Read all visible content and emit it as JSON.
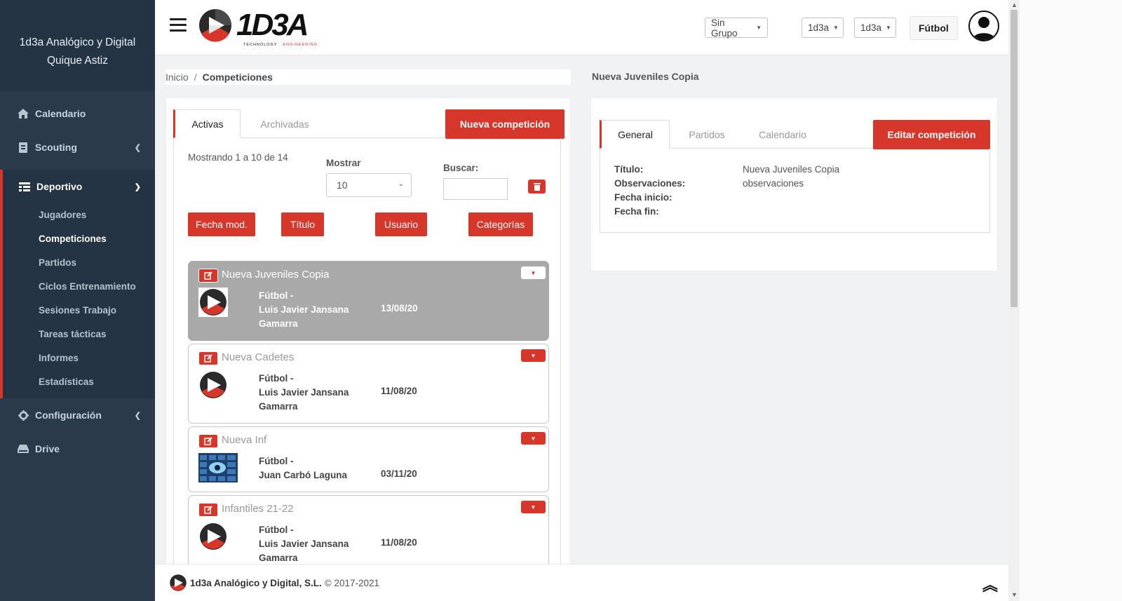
{
  "sidebar": {
    "company": "1d3a Analógico y Digital",
    "user": "Quique Astiz",
    "items": [
      {
        "label": "Calendario",
        "icon": "home-icon"
      },
      {
        "label": "Scouting",
        "icon": "id-card-icon"
      },
      {
        "label": "Deportivo",
        "icon": "table-icon"
      },
      {
        "label": "Configuración",
        "icon": "gear-icon"
      },
      {
        "label": "Drive",
        "icon": "drive-icon"
      }
    ],
    "submenu": [
      "Jugadores",
      "Competiciones",
      "Partidos",
      "Ciclos Entrenamiento",
      "Sesiones Trabajo",
      "Tareas tácticas",
      "Informes",
      "Estadísticas"
    ]
  },
  "topbar": {
    "logo_text": "1D3A",
    "logo_sub_1": "TECHNOLOGY",
    "logo_sub_2": "ENGINEERING",
    "group_select": "Sin Grupo",
    "club_select_1": "1d3a",
    "club_select_2": "1d3a",
    "sport": "Fútbol"
  },
  "breadcrumb": {
    "home": "Inicio",
    "sep": "/",
    "current": "Competiciones"
  },
  "left": {
    "tabs": [
      "Activas",
      "Archivadas"
    ],
    "new_button": "Nueva competición",
    "showing": "Mostrando 1 a 10 de 14",
    "show_label": "Mostrar",
    "show_value": "10",
    "search_label": "Buscar:",
    "sort_buttons": [
      "Fecha mod.",
      "Título",
      "Usuario",
      "Categorías"
    ],
    "competitions": [
      {
        "name": "Nueva Juveniles Copia",
        "sport": "Fútbol -",
        "user_1": "Luis Javier Jansana",
        "user_2": "Gamarra",
        "date": "13/08/20",
        "thumb": "logo"
      },
      {
        "name": "Nueva Cadetes",
        "sport": "Fútbol -",
        "user_1": "Luis Javier Jansana",
        "user_2": "Gamarra",
        "date": "11/08/20",
        "thumb": "logo"
      },
      {
        "name": "Nueva Inf",
        "sport": "Fútbol -",
        "user_1": "Juan Carbó Laguna",
        "user_2": "",
        "date": "03/11/20",
        "thumb": "photo"
      },
      {
        "name": "Infantiles 21-22",
        "sport": "Fútbol -",
        "user_1": "Luis Javier Jansana",
        "user_2": "Gamarra",
        "date": "11/08/20",
        "thumb": "logo"
      }
    ]
  },
  "right": {
    "title": "Nueva Juveniles Copia",
    "tabs": [
      "General",
      "Partidos",
      "Calendario"
    ],
    "edit_button": "Editar competición",
    "fields": [
      {
        "key": "Título:",
        "value": "Nueva Juveniles Copia"
      },
      {
        "key": "Observaciones:",
        "value": "observaciones"
      },
      {
        "key": "Fecha inicio:",
        "value": ""
      },
      {
        "key": "Fecha fin:",
        "value": ""
      }
    ]
  },
  "footer": {
    "company": "1d3a Analógico y Digital, S.L.",
    "copyright": "© 2017-2021"
  },
  "colors": {
    "accent": "#d7372a",
    "sidebar": "#2b3a4b"
  }
}
